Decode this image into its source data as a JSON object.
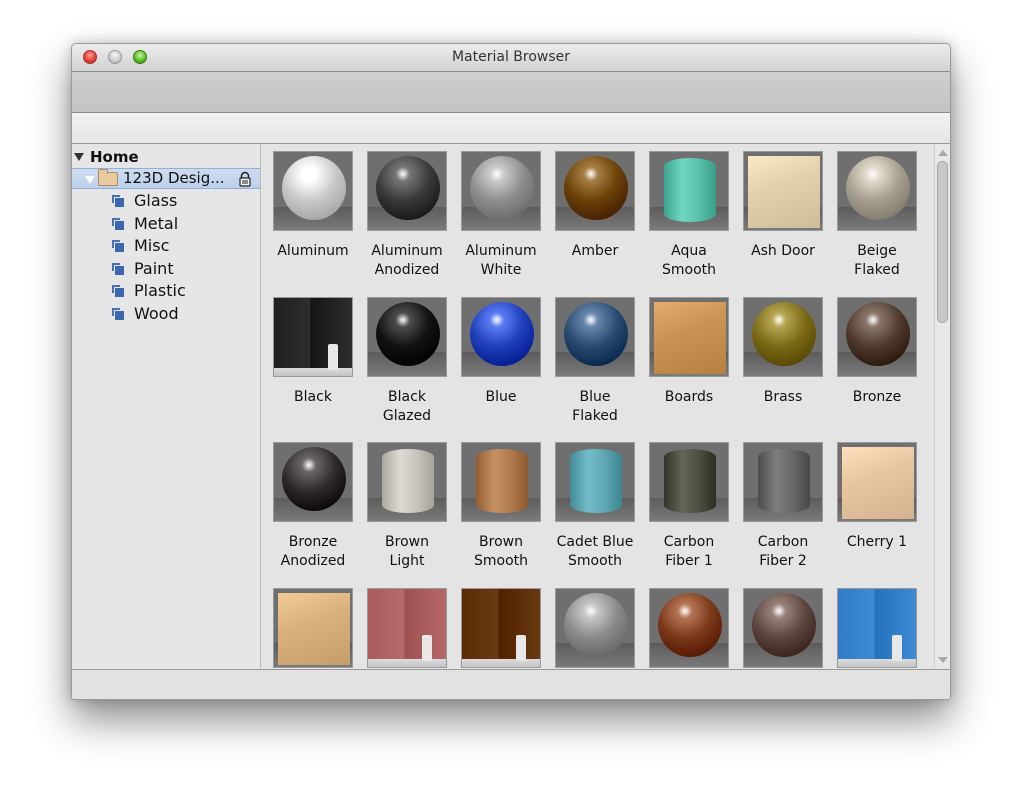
{
  "window": {
    "title": "Material Browser"
  },
  "sidebar": {
    "home_label": "Home",
    "library": {
      "label": "123D Desig...",
      "locked": true,
      "icon": "folder-icon"
    },
    "categories": [
      {
        "label": "Glass"
      },
      {
        "label": "Metal"
      },
      {
        "label": "Misc"
      },
      {
        "label": "Paint"
      },
      {
        "label": "Plastic"
      },
      {
        "label": "Wood"
      }
    ]
  },
  "materials": [
    {
      "name": "Aluminum",
      "shape": "sphere",
      "color": "#c9c9c9"
    },
    {
      "name": "Aluminum Anodized",
      "shape": "sphere",
      "color": "#3a3a3a"
    },
    {
      "name": "Aluminum White",
      "shape": "sphere",
      "color": "#8e8e8e"
    },
    {
      "name": "Amber",
      "shape": "sphere",
      "color": "#6a4208"
    },
    {
      "name": "Aqua Smooth",
      "shape": "cylinder",
      "color": "#5cc2ae"
    },
    {
      "name": "Ash Door",
      "shape": "cube",
      "color": "#e3d1ad"
    },
    {
      "name": "Beige Flaked",
      "shape": "sphere",
      "color": "#a69f90"
    },
    {
      "name": "Black",
      "shape": "wall",
      "color": "#2e2e2e"
    },
    {
      "name": "Black Glazed",
      "shape": "sphere",
      "color": "#111111"
    },
    {
      "name": "Blue",
      "shape": "sphere",
      "color": "#1f3fb8"
    },
    {
      "name": "Blue Flaked",
      "shape": "sphere",
      "color": "#2b4a70"
    },
    {
      "name": "Boards",
      "shape": "cube",
      "color": "#c99456"
    },
    {
      "name": "Brass",
      "shape": "sphere",
      "color": "#7a6a16"
    },
    {
      "name": "Bronze",
      "shape": "sphere",
      "color": "#4e3b2e"
    },
    {
      "name": "Bronze Anodized",
      "shape": "sphere",
      "color": "#2e2a2a"
    },
    {
      "name": "Brown Light",
      "shape": "cylinder",
      "color": "#c9c6bd"
    },
    {
      "name": "Brown Smooth",
      "shape": "cylinder",
      "color": "#b07c50"
    },
    {
      "name": "Cadet Blue Smooth",
      "shape": "cylinder",
      "color": "#5fa8b4"
    },
    {
      "name": "Carbon Fiber 1",
      "shape": "cylinder",
      "color": "#4f5145"
    },
    {
      "name": "Carbon Fiber 2",
      "shape": "cylinder",
      "color": "#6a6a6a"
    },
    {
      "name": "Cherry 1",
      "shape": "cube",
      "color": "#e8c6a4"
    },
    {
      "name": "",
      "shape": "cube",
      "color": "#d9b27e"
    },
    {
      "name": "",
      "shape": "wall",
      "color": "#b86a6a"
    },
    {
      "name": "",
      "shape": "wall",
      "color": "#6a3a12"
    },
    {
      "name": "",
      "shape": "sphere",
      "color": "#8a8a8a"
    },
    {
      "name": "",
      "shape": "sphere",
      "color": "#7a3a1a"
    },
    {
      "name": "",
      "shape": "sphere",
      "color": "#5e4640"
    },
    {
      "name": "",
      "shape": "wall",
      "color": "#3f8ad4"
    }
  ]
}
